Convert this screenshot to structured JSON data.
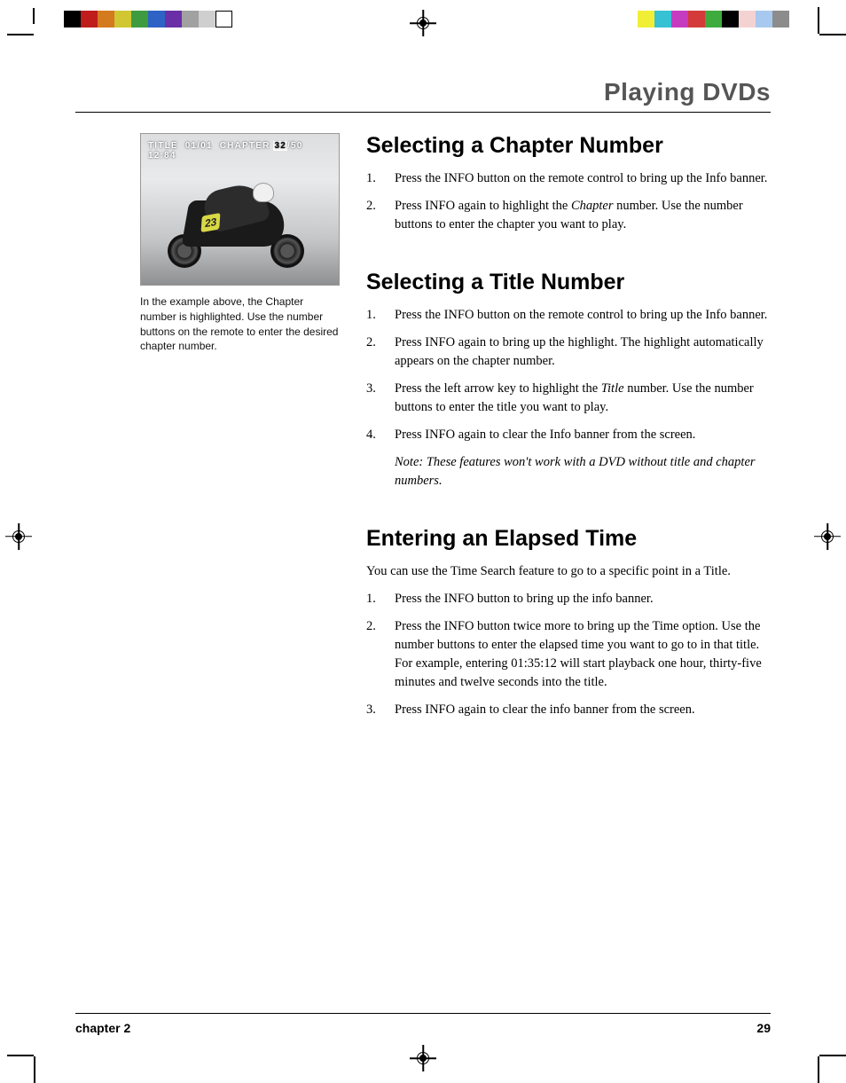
{
  "header": {
    "section_title": "Playing DVDs"
  },
  "swatches_left": [
    "#000000",
    "#bf1c1c",
    "#d47a1f",
    "#d0c732",
    "#3f9b40",
    "#2e62c4",
    "#6a2fa6",
    "#a1a1a1",
    "#cfcfcf",
    "#ffffff"
  ],
  "swatches_right": [
    "#f0ef35",
    "#36c1d4",
    "#c63cc1",
    "#d43a3a",
    "#3eab3e",
    "#000000",
    "#f5d2d2",
    "#a7c9f0",
    "#8c8c8c"
  ],
  "sidebar": {
    "overlay": {
      "title_label": "TITLE",
      "title_value": "01/01",
      "chapter_label": "CHAPTER",
      "chapter_highlight": "32",
      "chapter_total": "/50",
      "time": "12:84"
    },
    "rider_number": "23",
    "caption": "In the example above, the Chapter number is highlighted. Use the number buttons on the remote to enter the desired chapter number."
  },
  "sections": {
    "select_chapter": {
      "heading": "Selecting a Chapter Number",
      "steps": [
        "Press the INFO button on the remote control to bring up the Info banner.",
        "Press INFO again to highlight the <em class=\"italic-ref\">Chapter</em> number. Use the number buttons to enter the chapter you want to play."
      ]
    },
    "select_title": {
      "heading": "Selecting a Title Number",
      "steps": [
        "Press the INFO button on the remote control to bring up the Info banner.",
        "Press INFO again to bring up the highlight. The highlight automatically appears on the chapter number.",
        "Press the left arrow key to highlight the <em class=\"italic-ref\">Title</em> number. Use the number buttons to enter the title you want to play.",
        "Press INFO again to clear the Info banner from the screen."
      ],
      "note": "Note: These features won't work with a DVD without title and chapter numbers."
    },
    "elapsed_time": {
      "heading": "Entering an Elapsed Time",
      "intro": "You can use the Time Search feature to go to a specific point in a Title.",
      "steps": [
        "Press the INFO button to bring up the info banner.",
        "Press the INFO button twice more to bring up the Time option. Use the number buttons to enter the elapsed time you want to go to in that title. For example, entering 01:35:12 will start playback one hour, thirty-five minutes and twelve seconds into the title.",
        "Press INFO again to clear the info banner from the screen."
      ]
    }
  },
  "footer": {
    "left": "chapter 2",
    "right": "29"
  }
}
